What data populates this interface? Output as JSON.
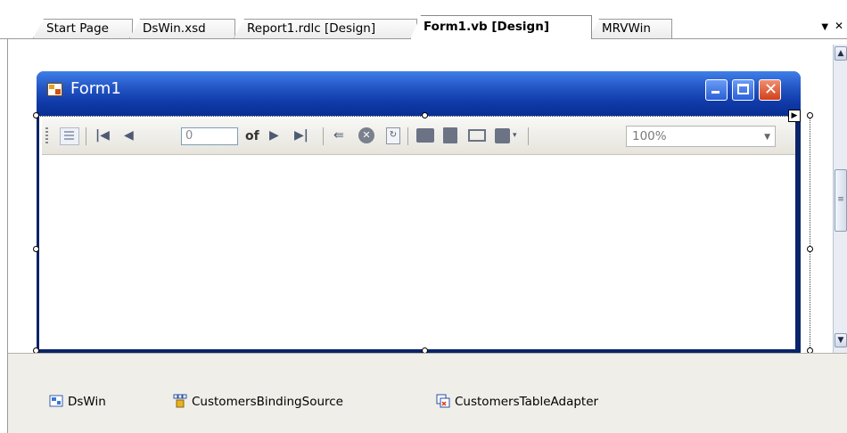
{
  "tabs": [
    {
      "label": "Start Page",
      "active": false
    },
    {
      "label": "DsWin.xsd",
      "active": false
    },
    {
      "label": "Report1.rdlc [Design]",
      "active": false
    },
    {
      "label": "Form1.vb [Design]",
      "active": true
    },
    {
      "label": "MRVWin",
      "active": false
    }
  ],
  "tab_controls": {
    "dropdown_icon": "chevron-down-icon",
    "close_icon": "close-icon"
  },
  "form": {
    "title": "Form1",
    "window_buttons": [
      "minimize-icon",
      "maximize-icon",
      "close-icon"
    ]
  },
  "report_toolbar": {
    "page_value": "0",
    "of_label": "of",
    "zoom_value": "100%"
  },
  "component_tray": [
    {
      "label": "DsWin",
      "icon": "dataset-icon"
    },
    {
      "label": "CustomersBindingSource",
      "icon": "binding-source-icon"
    },
    {
      "label": "CustomersTableAdapter",
      "icon": "table-adapter-icon"
    }
  ],
  "colors": {
    "titlebar": "#0f3aa8",
    "close_button": "#d0401c",
    "tray_background": "#efeee9"
  }
}
